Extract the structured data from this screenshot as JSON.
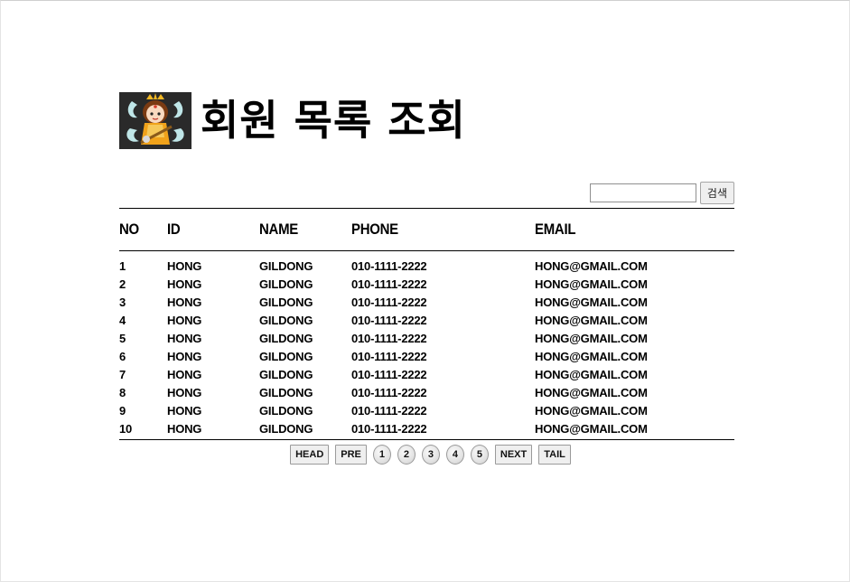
{
  "header": {
    "logo_icon": "character-avatar-icon",
    "title": "회원 목록 조회"
  },
  "search": {
    "input_value": "",
    "placeholder": "",
    "button_label": "검색"
  },
  "table": {
    "columns": [
      "NO",
      "ID",
      "NAME",
      "PHONE",
      "EMAIL"
    ],
    "rows": [
      {
        "no": "1",
        "id": "HONG",
        "name": "GILDONG",
        "phone": "010-1111-2222",
        "email": "HONG@GMAIL.COM"
      },
      {
        "no": "2",
        "id": "HONG",
        "name": "GILDONG",
        "phone": "010-1111-2222",
        "email": "HONG@GMAIL.COM"
      },
      {
        "no": "3",
        "id": "HONG",
        "name": "GILDONG",
        "phone": "010-1111-2222",
        "email": "HONG@GMAIL.COM"
      },
      {
        "no": "4",
        "id": "HONG",
        "name": "GILDONG",
        "phone": "010-1111-2222",
        "email": "HONG@GMAIL.COM"
      },
      {
        "no": "5",
        "id": "HONG",
        "name": "GILDONG",
        "phone": "010-1111-2222",
        "email": "HONG@GMAIL.COM"
      },
      {
        "no": "6",
        "id": "HONG",
        "name": "GILDONG",
        "phone": "010-1111-2222",
        "email": "HONG@GMAIL.COM"
      },
      {
        "no": "7",
        "id": "HONG",
        "name": "GILDONG",
        "phone": "010-1111-2222",
        "email": "HONG@GMAIL.COM"
      },
      {
        "no": "8",
        "id": "HONG",
        "name": "GILDONG",
        "phone": "010-1111-2222",
        "email": "HONG@GMAIL.COM"
      },
      {
        "no": "9",
        "id": "HONG",
        "name": "GILDONG",
        "phone": "010-1111-2222",
        "email": "HONG@GMAIL.COM"
      },
      {
        "no": "10",
        "id": "HONG",
        "name": "GILDONG",
        "phone": "010-1111-2222",
        "email": "HONG@GMAIL.COM"
      }
    ]
  },
  "pagination": {
    "head_label": "HEAD",
    "prev_label": "PRE",
    "pages": [
      "1",
      "2",
      "3",
      "4",
      "5"
    ],
    "next_label": "NEXT",
    "tail_label": "TAIL"
  }
}
